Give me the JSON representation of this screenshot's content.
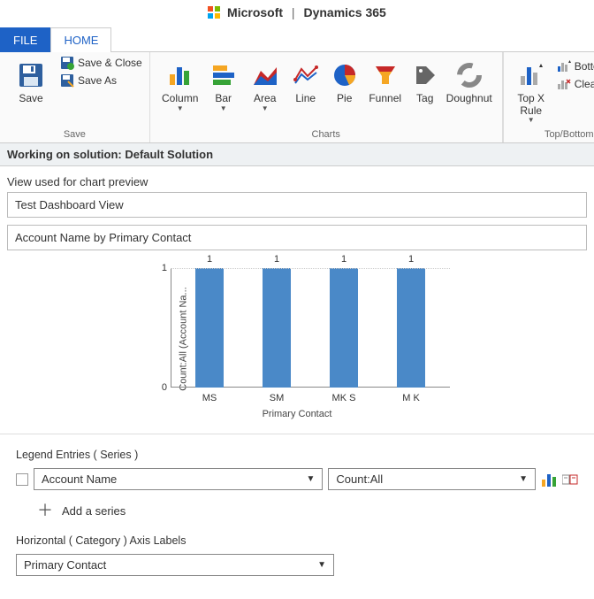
{
  "brand": {
    "company": "Microsoft",
    "product": "Dynamics 365"
  },
  "tabs": {
    "file": "FILE",
    "home": "HOME"
  },
  "ribbon": {
    "save": {
      "save": "Save",
      "save_close": "Save & Close",
      "save_as": "Save As",
      "group_label": "Save"
    },
    "charts": {
      "column": "Column",
      "bar": "Bar",
      "area": "Area",
      "line": "Line",
      "pie": "Pie",
      "funnel": "Funnel",
      "tag": "Tag",
      "doughnut": "Doughnut",
      "group_label": "Charts"
    },
    "rules": {
      "topx": "Top X\nRule",
      "bottomx": "Bottom X Rule",
      "clear": "Clear Rules",
      "group_label": "Top/Bottom Rules"
    }
  },
  "work_header": "Working on solution: Default Solution",
  "view_label": "View used for chart preview",
  "view_value": "Test Dashboard View",
  "chart_title_value": "Account Name by Primary Contact",
  "chart_data": {
    "type": "bar",
    "categories": [
      "MS",
      "SM",
      "MK S",
      "M K"
    ],
    "values": [
      1,
      1,
      1,
      1
    ],
    "xlabel": "Primary Contact",
    "ylabel": "Count:All (Account Na...",
    "ylim": [
      0,
      1
    ],
    "title": ""
  },
  "config": {
    "legend_label": "Legend Entries ( Series )",
    "series_field": "Account Name",
    "series_agg": "Count:All",
    "add_series": "Add a series",
    "haxis_label": "Horizontal ( Category ) Axis Labels",
    "haxis_value": "Primary Contact"
  }
}
